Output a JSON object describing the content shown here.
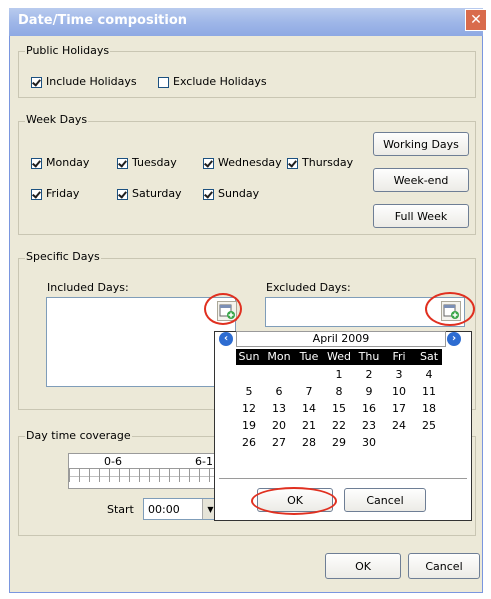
{
  "window": {
    "title": "Date/Time composition",
    "close_glyph": "✕"
  },
  "public_holidays": {
    "legend": "Public Holidays",
    "include_label": "Include Holidays",
    "include_checked": true,
    "exclude_label": "Exclude Holidays",
    "exclude_checked": false
  },
  "week_days": {
    "legend": "Week Days",
    "days": [
      {
        "label": "Monday",
        "checked": true
      },
      {
        "label": "Tuesday",
        "checked": true
      },
      {
        "label": "Wednesday",
        "checked": true
      },
      {
        "label": "Thursday",
        "checked": true
      },
      {
        "label": "Friday",
        "checked": true
      },
      {
        "label": "Saturday",
        "checked": true
      },
      {
        "label": "Sunday",
        "checked": true
      }
    ],
    "buttons": {
      "working": "Working Days",
      "weekend": "Week-end",
      "full": "Full Week"
    }
  },
  "specific_days": {
    "legend": "Specific Days",
    "included_label": "Included Days:",
    "excluded_label": "Excluded Days:",
    "add_icon": "calendar-add-icon"
  },
  "calendar": {
    "month_label": "April 2009",
    "prev_icon": "chevron-left-icon",
    "next_icon": "chevron-right-icon",
    "weekdays": [
      "Sun",
      "Mon",
      "Tue",
      "Wed",
      "Thu",
      "Fri",
      "Sat"
    ],
    "weeks": [
      [
        "",
        "",
        "",
        "1",
        "2",
        "3",
        "4"
      ],
      [
        "5",
        "6",
        "7",
        "8",
        "9",
        "10",
        "11"
      ],
      [
        "12",
        "13",
        "14",
        "15",
        "16",
        "17",
        "18"
      ],
      [
        "19",
        "20",
        "21",
        "22",
        "23",
        "24",
        "25"
      ],
      [
        "26",
        "27",
        "28",
        "29",
        "30",
        "",
        ""
      ]
    ],
    "ok_label": "OK",
    "cancel_label": "Cancel"
  },
  "day_time_coverage": {
    "legend": "Day time coverage",
    "ruler_label_1": "0-6",
    "ruler_label_2": "6-1",
    "start_label": "Start",
    "start_value": "00:00"
  },
  "dialog_buttons": {
    "ok": "OK",
    "cancel": "Cancel"
  },
  "colors": {
    "annotation_red": "#e03020",
    "title_bar": "#9fb7e8",
    "calendar_header": "#000000"
  }
}
